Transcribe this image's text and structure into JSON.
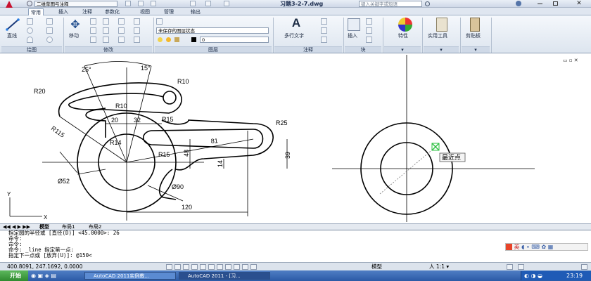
{
  "titlebar": {
    "workspace": "二维草图与注释",
    "doc_title": "习题3-2-7.dwg",
    "search_placeholder": "键入关键字或短语"
  },
  "ribbon_tabs": [
    "常用",
    "插入",
    "注释",
    "参数化",
    "视图",
    "管理",
    "输出"
  ],
  "panels": {
    "draw": {
      "label": "绘图",
      "line": "直线"
    },
    "modify": {
      "label": "修改",
      "move": "移动"
    },
    "layers": {
      "label": "图层",
      "state": "未保存的图层状态",
      "current": "0"
    },
    "annotation": {
      "label": "注释",
      "mtext": "多行文字"
    },
    "block": {
      "label": "块",
      "insert": "插入"
    },
    "properties": {
      "label": "特性"
    },
    "utilities": {
      "label": "实用工具"
    },
    "clipboard": {
      "label": "剪贴板"
    }
  },
  "dimensions": {
    "a25": "25°",
    "a15": "15°",
    "r10_top": "R10",
    "r20": "R20",
    "r10_mid": "R10",
    "r115": "R115",
    "d20": "20",
    "d32": "32",
    "r15_a": "R15",
    "r25": "R25",
    "d81": "81",
    "r14": "R14",
    "r15_b": "R15",
    "d48": "48",
    "d14": "14",
    "d39": "39",
    "dia52": "Ø52",
    "dia90": "Ø90",
    "d120": "120"
  },
  "snap_tooltip": "最近点",
  "layout_tabs": [
    "模型",
    "布局1",
    "布局2"
  ],
  "command_lines": [
    "指定圆的半径或 [直径(D)] <45.0000>: 26",
    "命令:",
    "命令:",
    "命令: _line 指定第一点:",
    "指定下一点或 [放弃(U)]:      @150<"
  ],
  "status": {
    "coords": "400.8091, 247.1692, 0.0000",
    "model": "模型",
    "scale": "1:1"
  },
  "ime": {
    "label": "英"
  },
  "taskbar": {
    "start": "开始",
    "items": [
      "AutoCAD 2011实例教...",
      "AutoCAD 2011 - [习..."
    ],
    "clock": "23:19"
  },
  "colors": {
    "ribbon_bg": "#dde5ef",
    "taskbar": "#2b5aa6",
    "snap_marker": "#2bbf3f"
  }
}
